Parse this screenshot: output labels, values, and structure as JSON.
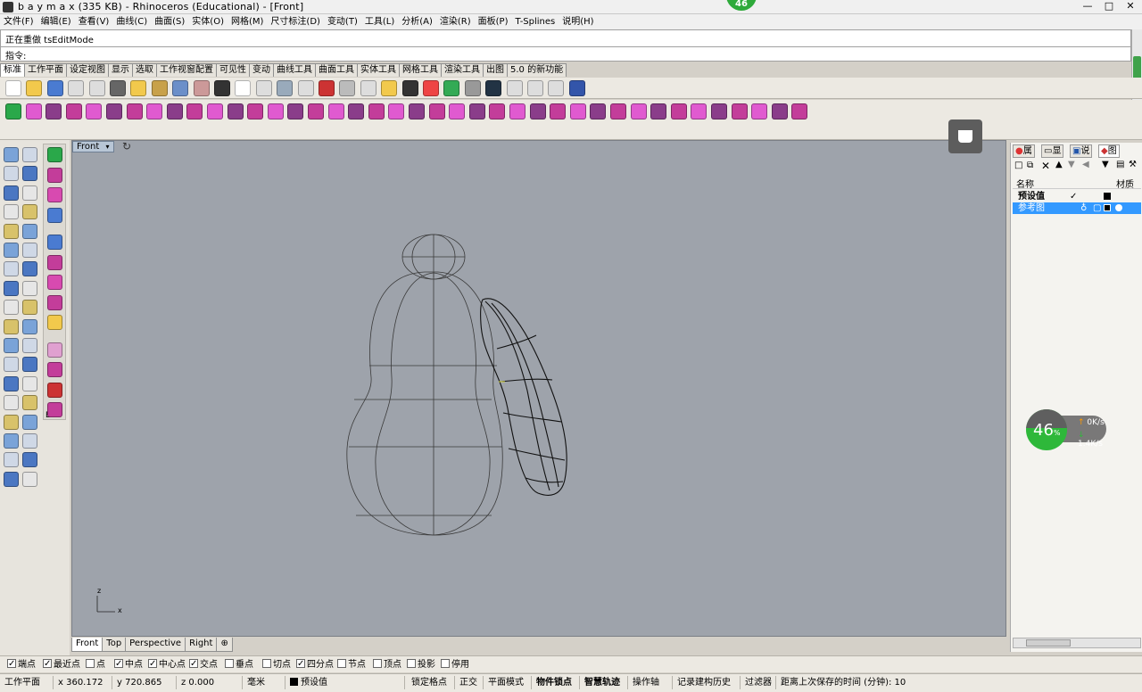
{
  "window": {
    "title": "b a y m a x (335 KB) - Rhinoceros (Educational) - [Front]",
    "net_bubble": "46",
    "controls": {
      "min": "—",
      "max": "□",
      "close": "✕"
    }
  },
  "menu": [
    "文件(F)",
    "编辑(E)",
    "查看(V)",
    "曲线(C)",
    "曲面(S)",
    "实体(O)",
    "网格(M)",
    "尺寸标注(D)",
    "变动(T)",
    "工具(L)",
    "分析(A)",
    "渲染(R)",
    "面板(P)",
    "T-Splines",
    "说明(H)"
  ],
  "command": {
    "history": "正在重做 tsEditMode",
    "prompt_label": "指令:"
  },
  "toolbar_tabs": [
    "标准",
    "工作平面",
    "设定视图",
    "显示",
    "选取",
    "工作视窗配置",
    "可见性",
    "变动",
    "曲线工具",
    "曲面工具",
    "实体工具",
    "网格工具",
    "渲染工具",
    "出图",
    "5.0 的新功能"
  ],
  "toolbar_tabs_active": 0,
  "left_palette": {
    "label": "E 2"
  },
  "viewport": {
    "name": "Front",
    "axis_z": "z",
    "axis_x": "x",
    "tabs": [
      "Front",
      "Top",
      "Perspective",
      "Right"
    ],
    "add_tab": "⊕"
  },
  "right_panel": {
    "tabs": [
      "属",
      "显",
      "说",
      "图"
    ],
    "col_name": "名称",
    "col_material": "材质",
    "layers": [
      {
        "name": "预设值",
        "current": "✓",
        "color": "#000000",
        "selected": false
      },
      {
        "name": "参考图",
        "color": "#000000",
        "selected": true
      }
    ]
  },
  "net_widget": {
    "percent": "46",
    "percent_sign": "%",
    "up": "0K/s",
    "down": "1.4K/s"
  },
  "osnaps": [
    {
      "label": "端点",
      "checked": true
    },
    {
      "label": "最近点",
      "checked": true
    },
    {
      "label": "点",
      "checked": false
    },
    {
      "label": "中点",
      "checked": true
    },
    {
      "label": "中心点",
      "checked": true
    },
    {
      "label": "交点",
      "checked": true
    },
    {
      "label": "垂点",
      "checked": false
    },
    {
      "label": "切点",
      "checked": false
    },
    {
      "label": "四分点",
      "checked": true
    },
    {
      "label": "节点",
      "checked": false
    },
    {
      "label": "顶点",
      "checked": false
    },
    {
      "label": "投影",
      "checked": false
    },
    {
      "label": "停用",
      "checked": false
    }
  ],
  "status": {
    "cplane": "工作平面",
    "x": "x 360.172",
    "y": "y 720.865",
    "z": "z 0.000",
    "unit": "毫米",
    "layer": "预设值",
    "grid_snap": "锁定格点",
    "ortho": "正交",
    "planar": "平面模式",
    "osnap": "物件锁点",
    "smarttrack": "智慧轨迹",
    "gumball": "操作轴",
    "history": "记录建构历史",
    "filter": "过滤器",
    "autosave": "距离上次保存的时间 (分钟): 10"
  }
}
